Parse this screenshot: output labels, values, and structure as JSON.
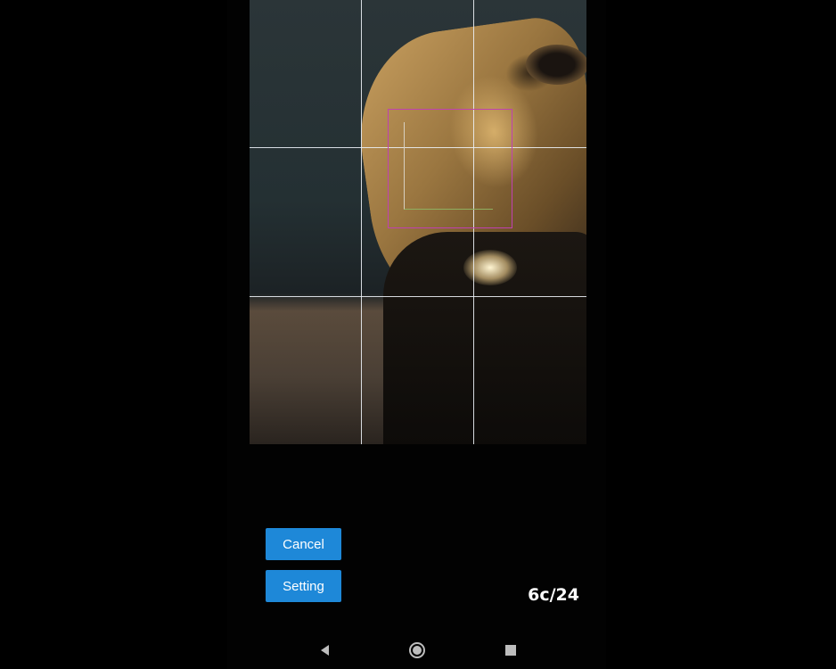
{
  "viewfinder": {
    "grid": "3x3",
    "focus_box_color": "#c040b0"
  },
  "controls": {
    "cancel_label": "Cancel",
    "setting_label": "Setting",
    "accent_color": "#1e88d8"
  },
  "status": {
    "counter": "6c/24"
  },
  "navbar": {
    "back_icon": "back-triangle-icon",
    "home_icon": "home-circle-icon",
    "recent_icon": "recent-square-icon"
  }
}
